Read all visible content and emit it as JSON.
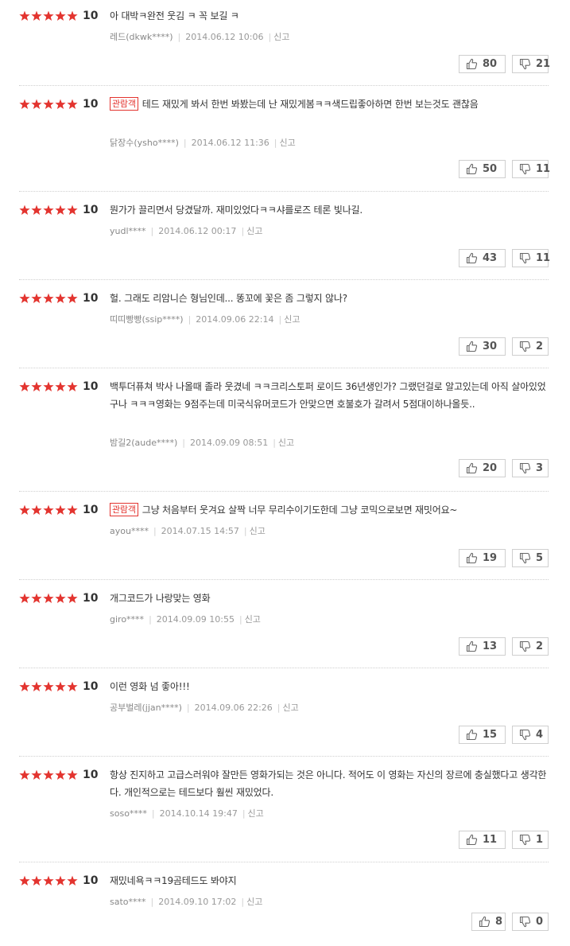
{
  "colors": {
    "star": "#e3342f",
    "badge": "#e3342f"
  },
  "icons": {
    "rating": "star-icon",
    "like": "thumbs-up-icon",
    "dislike": "thumbs-down-icon"
  },
  "reviews": [
    {
      "score": "10",
      "badge": "",
      "text": "아 대박ㅋ완전 웃김 ㅋ 꼭 보길 ㅋ",
      "author": "레드(dkwk****)",
      "date": "2014.06.12 10:06",
      "report": "신고",
      "likes": "80",
      "dislikes": "21"
    },
    {
      "score": "10",
      "badge": "관람객",
      "text": "테드 재밌게 봐서 한번 봐봤는데 난 재밌게봄ㅋㅋ색드립좋아하면 한번 보는것도 괜찮음",
      "author": "닭장수(ysho****)",
      "date": "2014.06.12 11:36",
      "report": "신고",
      "likes": "50",
      "dislikes": "11"
    },
    {
      "score": "10",
      "badge": "",
      "text": "뭔가가 끌리면서 당겼달까. 재미있었다ㅋㅋ샤를로즈 테론 빛나길.",
      "author": "yudl****",
      "date": "2014.06.12 00:17",
      "report": "신고",
      "likes": "43",
      "dislikes": "11"
    },
    {
      "score": "10",
      "badge": "",
      "text": "헐. 그래도 리암니슨 형님인데... 똥꼬에 꽃은 좀 그렇지 않나?",
      "author": "띠띠빵빵(ssip****)",
      "date": "2014.09.06 22:14",
      "report": "신고",
      "likes": "30",
      "dislikes": "2"
    },
    {
      "score": "10",
      "badge": "",
      "text": "백투더퓨쳐 박사 나올때 졸라 웃겼네 ㅋㅋ크리스토퍼 로이드 36년생인가? 그랬던걸로 알고있는데 아직 살아있었구나 ㅋㅋㅋ영화는 9점주는데 미국식유머코드가 안맞으면 호불호가 갈려서 5점대이하나올듯..",
      "author": "밤길2(aude****)",
      "date": "2014.09.09 08:51",
      "report": "신고",
      "likes": "20",
      "dislikes": "3"
    },
    {
      "score": "10",
      "badge": "관람객",
      "text": "그냥 처음부터 웃겨요 살짝 너무 무리수이기도한데 그냥 코믹으로보면 재밋어요~",
      "author": "ayou****",
      "date": "2014.07.15 14:57",
      "report": "신고",
      "likes": "19",
      "dislikes": "5"
    },
    {
      "score": "10",
      "badge": "",
      "text": "개그코드가 나랑맞는 영화",
      "author": "giro****",
      "date": "2014.09.09 10:55",
      "report": "신고",
      "likes": "13",
      "dislikes": "2"
    },
    {
      "score": "10",
      "badge": "",
      "text": "이런 영화 넘 좋아!!!",
      "author": "공부벌레(jjan****)",
      "date": "2014.09.06 22:26",
      "report": "신고",
      "likes": "15",
      "dislikes": "4"
    },
    {
      "score": "10",
      "badge": "",
      "text": "항상 진지하고 고급스러워야 잘만든 영화가되는 것은 아니다. 적어도 이 영화는 자신의 장르에 충실했다고 생각한다. 개인적으로는 테드보다 훨씬 재밌었다.",
      "author": "soso****",
      "date": "2014.10.14 19:47",
      "report": "신고",
      "likes": "11",
      "dislikes": "1"
    },
    {
      "score": "10",
      "badge": "",
      "text": "재밌네욕ㅋㅋ19곰테드도 봐야지",
      "author": "sato****",
      "date": "2014.09.10 17:02",
      "report": "신고",
      "likes": "8",
      "dislikes": "0"
    }
  ]
}
